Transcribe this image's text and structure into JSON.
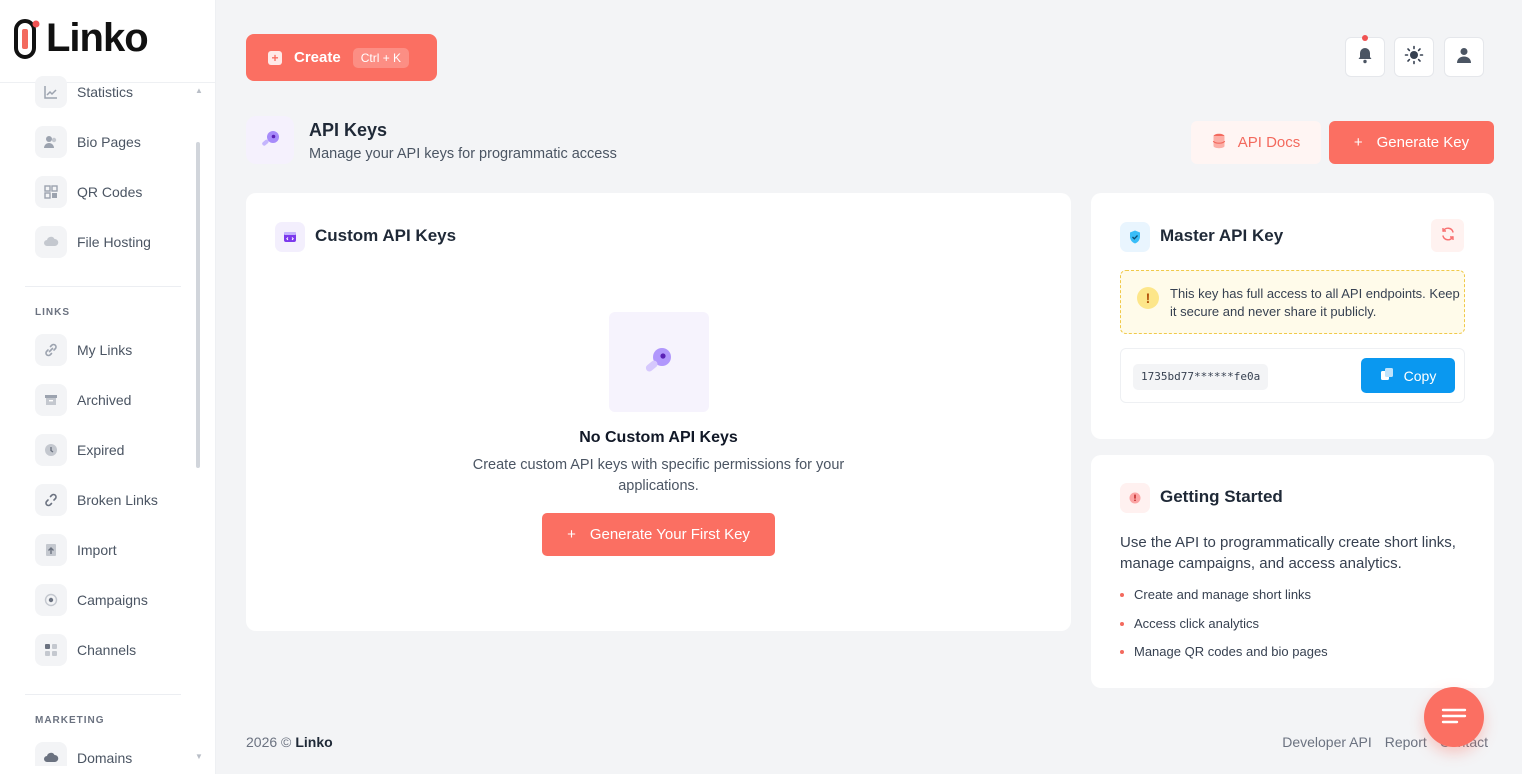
{
  "app": {
    "name": "Linko"
  },
  "sidebar": {
    "items_top": [
      {
        "label": "Statistics",
        "icon": "chart-line-icon"
      },
      {
        "label": "Bio Pages",
        "icon": "users-icon"
      },
      {
        "label": "QR Codes",
        "icon": "qr-code-icon"
      },
      {
        "label": "File Hosting",
        "icon": "cloud-icon"
      }
    ],
    "section_links": "LINKS",
    "items_links": [
      {
        "label": "My Links",
        "icon": "link-icon"
      },
      {
        "label": "Archived",
        "icon": "archive-icon"
      },
      {
        "label": "Expired",
        "icon": "clock-icon"
      },
      {
        "label": "Broken Links",
        "icon": "broken-link-icon"
      },
      {
        "label": "Import",
        "icon": "import-icon"
      },
      {
        "label": "Campaigns",
        "icon": "target-icon"
      },
      {
        "label": "Channels",
        "icon": "grid-icon"
      }
    ],
    "section_marketing": "MARKETING",
    "items_marketing": [
      {
        "label": "Domains",
        "icon": "cloud-icon"
      }
    ]
  },
  "topbar": {
    "create_label": "Create",
    "create_shortcut": "Ctrl + K"
  },
  "page": {
    "title": "API Keys",
    "subtitle": "Manage your API keys for programmatic access",
    "api_docs_label": "API Docs",
    "generate_key_label": "Generate Key"
  },
  "custom_keys": {
    "title": "Custom API Keys",
    "empty_title": "No Custom API Keys",
    "empty_desc": "Create custom API keys with specific permissions for your applications.",
    "cta_label": "Generate Your First Key"
  },
  "master_key": {
    "title": "Master API Key",
    "warning": "This key has full access to all API endpoints. Keep it secure and never share it publicly.",
    "key_value": "1735bd77******fe0a",
    "copy_label": "Copy"
  },
  "getting_started": {
    "title": "Getting Started",
    "description": "Use the API to programmatically create short links, manage campaigns, and access analytics.",
    "bullets": [
      "Create and manage short links",
      "Access click analytics",
      "Manage QR codes and bio pages"
    ]
  },
  "footer": {
    "copyright": "2026 ©",
    "brand": "Linko",
    "links": [
      "Developer API",
      "Report",
      "Contact"
    ]
  },
  "colors": {
    "accent": "#fb6f62",
    "copy_blue": "#0a98f0",
    "warning_bg": "#fffbea"
  }
}
